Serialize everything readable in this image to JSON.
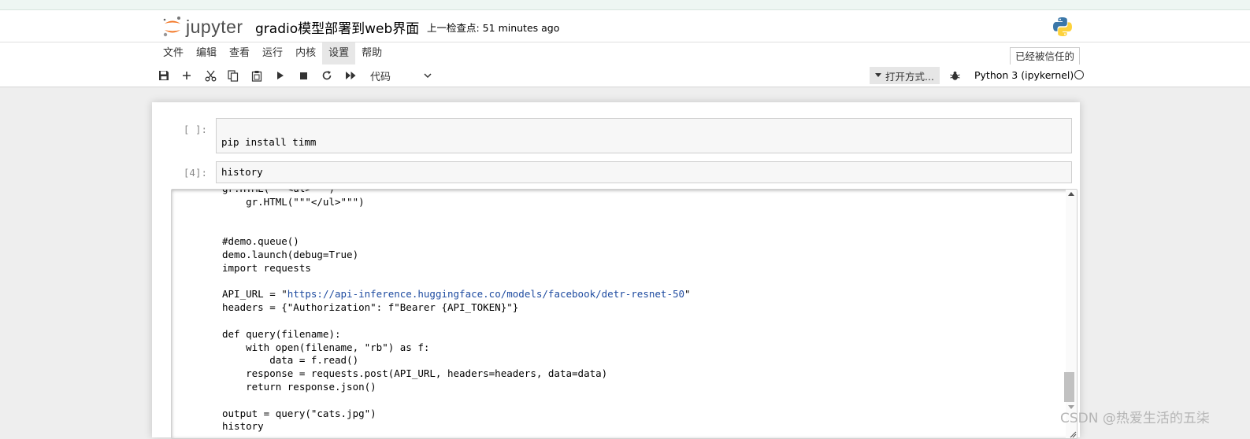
{
  "header": {
    "logo_text": "jupyter",
    "notebook_title": "gradio模型部署到web界面",
    "checkpoint": "上一检查点: 51 minutes ago"
  },
  "menu": {
    "items": [
      "文件",
      "编辑",
      "查看",
      "运行",
      "内核",
      "设置",
      "帮助"
    ],
    "active_item": "设置",
    "trusted_label": "已经被信任的"
  },
  "toolbar": {
    "buttons": [
      "save-icon",
      "plus-icon",
      "cut-icon",
      "copy-icon",
      "paste-icon",
      "run-icon",
      "stop-icon",
      "restart-icon",
      "fast-forward-icon"
    ],
    "cell_type": "代码",
    "open_with_label": "打开方式...",
    "kernel_name": "Python 3 (ipykernel)"
  },
  "cells": [
    {
      "prompt": "[ ]:",
      "source": "pip install timm"
    },
    {
      "prompt": "[4]:",
      "source": "history"
    }
  ],
  "output": {
    "lines_before_url": "gr.HTML(\"\"\"<ul>\"\"\")\n    gr.HTML(\"\"\"</ul>\"\"\")\n\n\n#demo.queue()\ndemo.launch(debug=True)\nimport requests\n\nAPI_URL = \"",
    "url": "https://api-inference.huggingface.co/models/facebook/detr-resnet-50",
    "lines_after_url": "\"\nheaders = {\"Authorization\": f\"Bearer {API_TOKEN}\"}\n\ndef query(filename):\n    with open(filename, \"rb\") as f:\n        data = f.read()\n    response = requests.post(API_URL, headers=headers, data=data)\n    return response.json()\n\noutput = query(\"cats.jpg\")\nhistory"
  },
  "watermark": "CSDN @热爱生活的五柒",
  "colors": {
    "jupyter_orange": "#f37726",
    "url_blue": "#1e4ba0",
    "page_bg": "#eeeeee",
    "input_bg": "#f7f7f7"
  }
}
